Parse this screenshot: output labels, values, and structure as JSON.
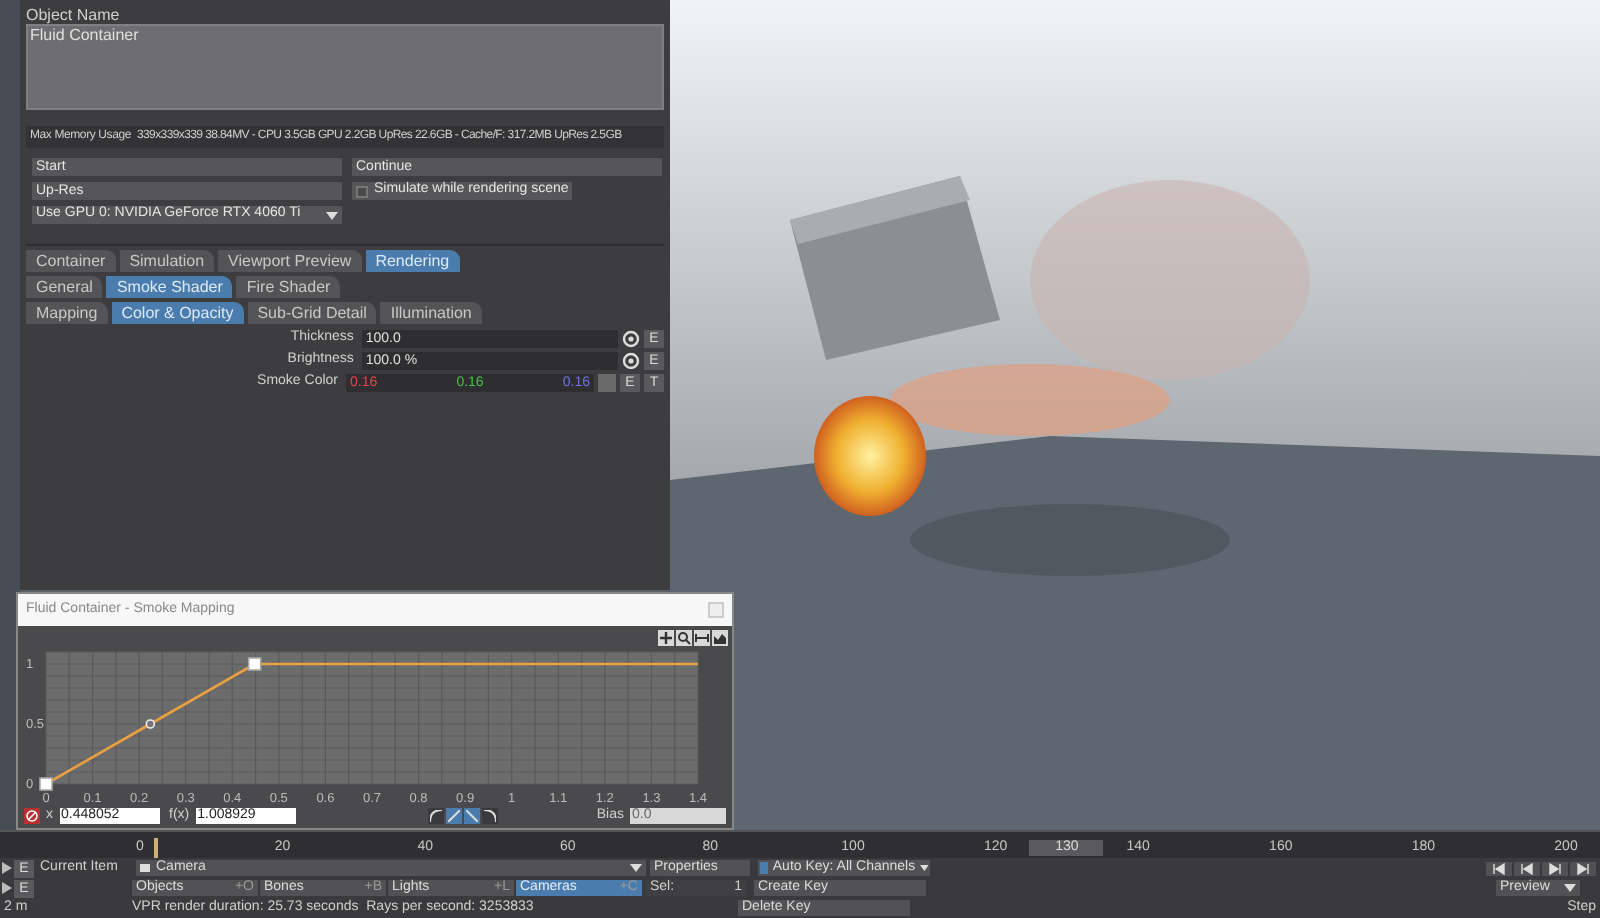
{
  "object_name": {
    "label": "Object Name",
    "value": "Fluid Container"
  },
  "memory": {
    "label": "Max Memory Usage",
    "value": "339x339x339 38.84MV - CPU 3.5GB GPU 2.2GB UpRes 22.6GB - Cache/F: 317.2MB UpRes 2.5GB"
  },
  "buttons": [
    {
      "label": "Start"
    },
    {
      "label": "Continue"
    },
    {
      "label": "Up-Res"
    }
  ],
  "simulate_checkbox": {
    "label": "Simulate while rendering scene",
    "checked": false
  },
  "gpu_select": {
    "value": "Use GPU 0: NVIDIA GeForce RTX 4060 Ti"
  },
  "tab_rows": [
    {
      "tabs": [
        {
          "label": "Container",
          "selected": false
        },
        {
          "label": "Simulation",
          "selected": false
        },
        {
          "label": "Viewport Preview",
          "selected": false
        },
        {
          "label": "Rendering",
          "selected": true
        }
      ]
    },
    {
      "tabs": [
        {
          "label": "General",
          "selected": false
        },
        {
          "label": "Smoke Shader",
          "selected": true
        },
        {
          "label": "Fire Shader",
          "selected": false
        }
      ]
    },
    {
      "tabs": [
        {
          "label": "Mapping",
          "selected": false
        },
        {
          "label": "Color & Opacity",
          "selected": true
        },
        {
          "label": "Sub-Grid Detail",
          "selected": false
        },
        {
          "label": "Illumination",
          "selected": false
        }
      ]
    }
  ],
  "fields": [
    {
      "kind": "number",
      "label": "Thickness",
      "value": "100.0",
      "buttons": [
        "E"
      ]
    },
    {
      "kind": "number",
      "label": "Brightness",
      "value": "100.0 %",
      "buttons": [
        "E"
      ]
    },
    {
      "kind": "color",
      "label": "Smoke Color",
      "components": [
        {
          "value": "0.16",
          "color": "#e04848"
        },
        {
          "value": "0.16",
          "color": "#48c048"
        },
        {
          "value": "0.16",
          "color": "#7070e8"
        }
      ],
      "buttons": [
        "E",
        "T"
      ]
    }
  ],
  "graph_window": {
    "title": "Fluid Container - Smoke Mapping",
    "chart_data": {
      "type": "line",
      "grid": true,
      "x": [
        0,
        0.224,
        0.448052,
        1.4
      ],
      "series": [
        {
          "color": "#e8a040",
          "values": [
            0,
            0.5,
            1,
            1
          ]
        }
      ],
      "xlim": [
        0,
        1.4
      ],
      "ylim": [
        0,
        1.1
      ],
      "xticks": [
        0,
        0.1,
        0.2,
        0.3,
        0.4,
        0.5,
        0.6,
        0.7,
        0.8,
        0.9,
        1,
        1.1,
        1.2,
        1.3,
        1.4
      ],
      "yticks": [
        0,
        0.5,
        1
      ]
    },
    "x_label": "x",
    "x_value": "0.448052",
    "fx_label": "f(x)",
    "fx_value": "1.008929",
    "curve_modes": [
      {
        "selected": false
      },
      {
        "selected": true
      },
      {
        "selected": true
      },
      {
        "selected": false
      }
    ],
    "bias_label": "Bias",
    "bias_value": "0.0"
  },
  "timeline": {
    "ticks": [
      "0",
      "20",
      "40",
      "60",
      "80",
      "100",
      "120",
      "140",
      "160",
      "180",
      "200"
    ],
    "range_marker": "130"
  },
  "row_buttons": [
    "E",
    "E"
  ],
  "scale_label": "2 m",
  "current_item": {
    "label": "Current Item",
    "value": "Camera"
  },
  "properties_button": "Properties",
  "auto_key": {
    "label": "Auto Key: All Channels",
    "checked": true
  },
  "item_types": [
    {
      "label": "Objects",
      "shortcut": "+O",
      "selected": false
    },
    {
      "label": "Bones",
      "shortcut": "+B",
      "selected": false
    },
    {
      "label": "Lights",
      "shortcut": "+L",
      "selected": false
    },
    {
      "label": "Cameras",
      "shortcut": "+C",
      "selected": true
    }
  ],
  "selection": {
    "label": "Sel:",
    "value": "1"
  },
  "create_key": "Create Key",
  "delete_key": "Delete Key",
  "status": "VPR render duration: 25.73 seconds  Rays per second: 3253833",
  "preview_select": "Preview",
  "step_label": "Step"
}
